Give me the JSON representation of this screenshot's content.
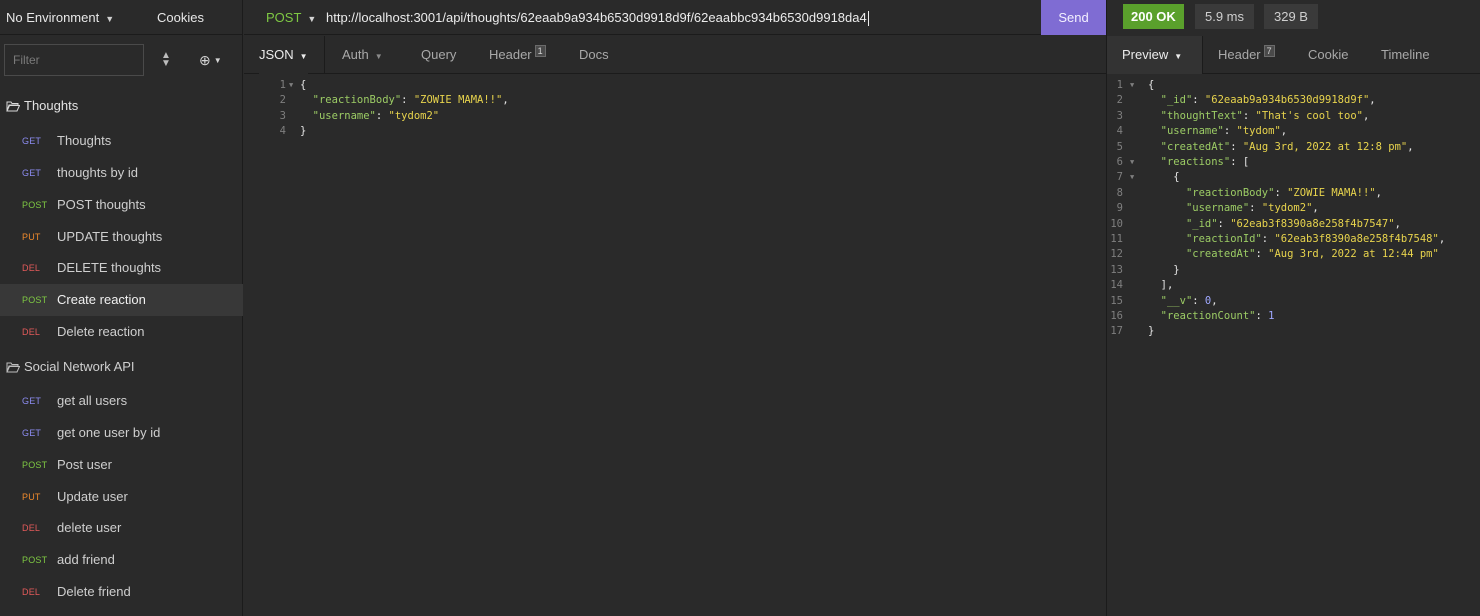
{
  "sidebar": {
    "environment": "No Environment",
    "cookies": "Cookies",
    "filter_placeholder": "Filter",
    "folders": [
      {
        "name": "Thoughts",
        "requests": [
          {
            "method": "GET",
            "name": "Thoughts"
          },
          {
            "method": "GET",
            "name": "thoughts by id"
          },
          {
            "method": "POST",
            "name": "POST thoughts"
          },
          {
            "method": "PUT",
            "name": "UPDATE thoughts"
          },
          {
            "method": "DEL",
            "name": "DELETE thoughts"
          },
          {
            "method": "POST",
            "name": "Create reaction",
            "active": true
          },
          {
            "method": "DEL",
            "name": "Delete reaction"
          }
        ]
      },
      {
        "name": "Social Network API",
        "requests": [
          {
            "method": "GET",
            "name": "get all users"
          },
          {
            "method": "GET",
            "name": "get one user by id"
          },
          {
            "method": "POST",
            "name": "Post user"
          },
          {
            "method": "PUT",
            "name": "Update user"
          },
          {
            "method": "DEL",
            "name": "delete user"
          },
          {
            "method": "POST",
            "name": "add friend"
          },
          {
            "method": "DEL",
            "name": "Delete friend"
          }
        ]
      }
    ]
  },
  "request": {
    "method": "POST",
    "url": "http://localhost:3001/api/thoughts/62eaab9a934b6530d9918d9f/62eaabbc934b6530d9918da4",
    "send_label": "Send",
    "tabs": {
      "json": "JSON",
      "auth": "Auth",
      "query": "Query",
      "header": "Header",
      "header_count": "1",
      "docs": "Docs"
    },
    "body_lines": [
      {
        "n": "1",
        "fold": true,
        "html": "<span class='pun'>{</span>"
      },
      {
        "n": "2",
        "html": "  <span class='key'>\"reactionBody\"</span><span class='pun'>: </span><span class='str'>\"ZOWIE MAMA!!\"</span><span class='pun'>,</span>"
      },
      {
        "n": "3",
        "html": "  <span class='key'>\"username\"</span><span class='pun'>: </span><span class='str'>\"tydom2\"</span>"
      },
      {
        "n": "4",
        "html": "<span class='pun'>}</span>"
      }
    ]
  },
  "response": {
    "status": "200 OK",
    "time": "5.9 ms",
    "size": "329 B",
    "tabs": {
      "preview": "Preview",
      "header": "Header",
      "header_count": "7",
      "cookie": "Cookie",
      "timeline": "Timeline"
    },
    "body_lines": [
      {
        "n": "1",
        "fold": true,
        "html": "<span class='pun'>{</span>"
      },
      {
        "n": "2",
        "html": "  <span class='key'>\"_id\"</span><span class='pun'>: </span><span class='str'>\"62eaab9a934b6530d9918d9f\"</span><span class='pun'>,</span>"
      },
      {
        "n": "3",
        "html": "  <span class='key'>\"thoughtText\"</span><span class='pun'>: </span><span class='str'>\"That's cool too\"</span><span class='pun'>,</span>"
      },
      {
        "n": "4",
        "html": "  <span class='key'>\"username\"</span><span class='pun'>: </span><span class='str'>\"tydom\"</span><span class='pun'>,</span>"
      },
      {
        "n": "5",
        "html": "  <span class='key'>\"createdAt\"</span><span class='pun'>: </span><span class='str'>\"Aug 3rd, 2022 at 12:8 pm\"</span><span class='pun'>,</span>"
      },
      {
        "n": "6",
        "fold": true,
        "html": "  <span class='key'>\"reactions\"</span><span class='pun'>: [</span>"
      },
      {
        "n": "7",
        "fold": true,
        "html": "    <span class='pun'>{</span>"
      },
      {
        "n": "8",
        "html": "      <span class='key'>\"reactionBody\"</span><span class='pun'>: </span><span class='str'>\"ZOWIE MAMA!!\"</span><span class='pun'>,</span>"
      },
      {
        "n": "9",
        "html": "      <span class='key'>\"username\"</span><span class='pun'>: </span><span class='str'>\"tydom2\"</span><span class='pun'>,</span>"
      },
      {
        "n": "10",
        "html": "      <span class='key'>\"_id\"</span><span class='pun'>: </span><span class='str'>\"62eab3f8390a8e258f4b7547\"</span><span class='pun'>,</span>"
      },
      {
        "n": "11",
        "html": "      <span class='key'>\"reactionId\"</span><span class='pun'>: </span><span class='str'>\"62eab3f8390a8e258f4b7548\"</span><span class='pun'>,</span>"
      },
      {
        "n": "12",
        "html": "      <span class='key'>\"createdAt\"</span><span class='pun'>: </span><span class='str'>\"Aug 3rd, 2022 at 12:44 pm\"</span>"
      },
      {
        "n": "13",
        "html": "    <span class='pun'>}</span>"
      },
      {
        "n": "14",
        "html": "  <span class='pun'>],</span>"
      },
      {
        "n": "15",
        "html": "  <span class='key'>\"__v\"</span><span class='pun'>: </span><span class='num'>0</span><span class='pun'>,</span>"
      },
      {
        "n": "16",
        "html": "  <span class='key'>\"reactionCount\"</span><span class='pun'>: </span><span class='num'>1</span>"
      },
      {
        "n": "17",
        "html": "<span class='pun'>}</span>"
      }
    ]
  },
  "colors": {
    "accent": "#7f6cd3",
    "status_ok": "#5aa02c",
    "get": "#8c8cf0",
    "post": "#7ec843",
    "put": "#f08a2c",
    "delete": "#e35a5a"
  }
}
